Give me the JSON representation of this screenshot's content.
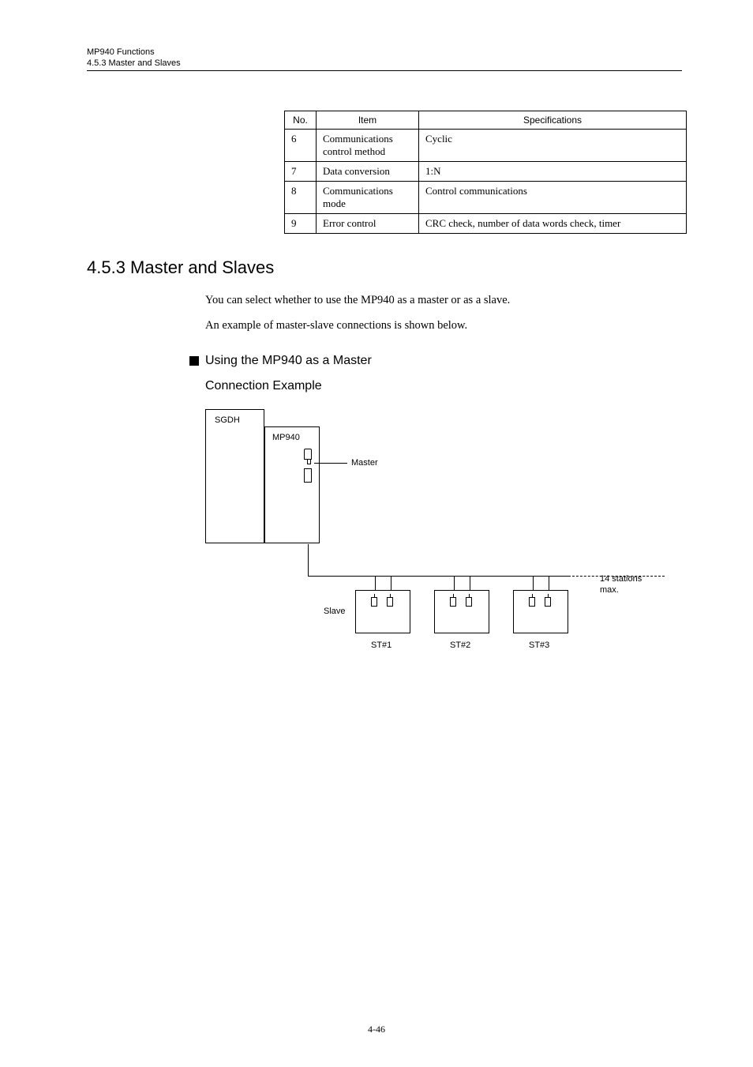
{
  "header": {
    "title": "MP940 Functions",
    "subtitle": "4.5.3  Master and Slaves"
  },
  "table": {
    "headers": {
      "no": "No.",
      "item": "Item",
      "spec": "Specifications"
    },
    "rows": [
      {
        "no": "6",
        "item": "Communications control method",
        "spec": "Cyclic"
      },
      {
        "no": "7",
        "item": "Data conversion",
        "spec": "1:N"
      },
      {
        "no": "8",
        "item": "Communications mode",
        "spec": "Control communications"
      },
      {
        "no": "9",
        "item": "Error control",
        "spec": "CRC check, number of data words check, timer"
      }
    ]
  },
  "section": {
    "heading": "4.5.3  Master and Slaves",
    "p1": "You can select whether to use the MP940 as a master or as a slave.",
    "p2": "An example of master-slave connections is shown below.",
    "sub": "Using the MP940 as a Master",
    "subsub": "Connection Example"
  },
  "diagram": {
    "sgdh": "SGDH",
    "mp940": "MP940",
    "master": "Master",
    "slave": "Slave",
    "st1": "ST#1",
    "st2": "ST#2",
    "st3": "ST#3",
    "note": "14 stations\nmax."
  },
  "page": "4-46"
}
